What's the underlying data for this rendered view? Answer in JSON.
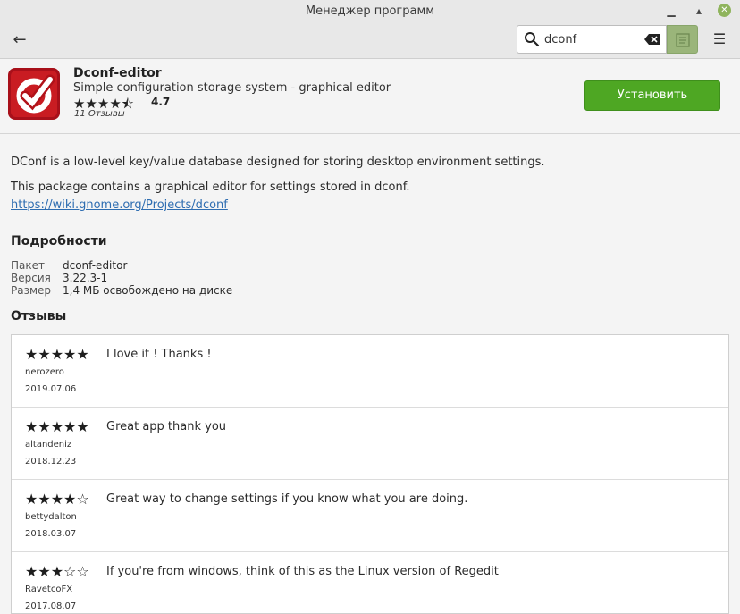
{
  "window": {
    "title": "Менеджер программ"
  },
  "header": {
    "back_icon": "arrow-left-icon",
    "search": {
      "value": "dconf",
      "icon": "search-icon"
    },
    "menu_icon": "hamburger-icon"
  },
  "app": {
    "name": "Dconf-editor",
    "summary": "Simple configuration storage system - graphical editor",
    "stars": "★★★★⯪",
    "rating": "4.7",
    "reviews_count": "11 Отзывы",
    "install_label": "Установить",
    "accent_color": "#4ea723"
  },
  "description": {
    "p1": "DConf is a low-level key/value database designed for storing desktop environment settings.",
    "p2": "This package contains a graphical editor for settings stored in dconf.",
    "link": "https://wiki.gnome.org/Projects/dconf"
  },
  "details": {
    "heading": "Подробности",
    "rows": [
      {
        "key": "Пакет",
        "value": "dconf-editor"
      },
      {
        "key": "Версия",
        "value": "3.22.3-1"
      },
      {
        "key": "Размер",
        "value": "1,4 МБ освобождено на диске"
      }
    ]
  },
  "reviews": {
    "heading": "Отзывы",
    "items": [
      {
        "stars": "★★★★★",
        "text": "I love it ! Thanks !",
        "author": "nerozero",
        "date": "2019.07.06"
      },
      {
        "stars": "★★★★★",
        "text": "Great app thank you",
        "author": "altandeniz",
        "date": "2018.12.23"
      },
      {
        "stars": "★★★★☆",
        "text": "Great way to change settings if you know what you are doing.",
        "author": "bettydalton",
        "date": "2018.03.07"
      },
      {
        "stars": "★★★☆☆",
        "text": "If you're from windows, think of this as the Linux version of Regedit",
        "author": "RavetcoFX",
        "date": "2017.08.07"
      }
    ]
  }
}
